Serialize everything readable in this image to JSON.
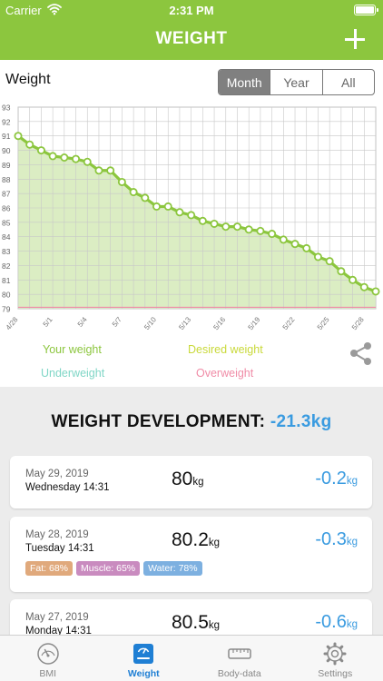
{
  "status_bar": {
    "carrier": "Carrier",
    "time": "2:31 PM"
  },
  "nav": {
    "title": "WEIGHT"
  },
  "chart_title": "Weight",
  "period_tabs": [
    "Month",
    "Year",
    "All"
  ],
  "active_period": "Month",
  "legend": {
    "your_weight": "Your weight",
    "desired_weight": "Desired weight",
    "underweight": "Underweight",
    "overweight": "Overweight"
  },
  "development": {
    "label": "WEIGHT DEVELOPMENT:",
    "value": "-21.3kg"
  },
  "entries": [
    {
      "date": "May 29, 2019",
      "day_time": "Wednesday 14:31",
      "weight": "80",
      "weight_unit": "kg",
      "change": "-0.2",
      "change_unit": "kg",
      "tags": []
    },
    {
      "date": "May 28, 2019",
      "day_time": "Tuesday 14:31",
      "weight": "80.2",
      "weight_unit": "kg",
      "change": "-0.3",
      "change_unit": "kg",
      "tags": [
        {
          "label": "Fat: 68%",
          "color": "#e0a97c"
        },
        {
          "label": "Muscle: 65%",
          "color": "#c98bbf"
        },
        {
          "label": "Water: 78%",
          "color": "#7db0e0"
        }
      ]
    },
    {
      "date": "May 27, 2019",
      "day_time": "Monday 14:31",
      "weight": "80.5",
      "weight_unit": "kg",
      "change": "-0.6",
      "change_unit": "kg",
      "tags": []
    }
  ],
  "tabs": [
    {
      "label": "BMI",
      "icon": "gauge-icon"
    },
    {
      "label": "Weight",
      "icon": "scale-icon"
    },
    {
      "label": "Body-data",
      "icon": "tape-measure-icon"
    },
    {
      "label": "Settings",
      "icon": "gear-icon"
    }
  ],
  "active_tab": "Weight",
  "colors": {
    "brand_green": "#8cc63e",
    "your_weight": "#8cc63e",
    "desired_weight": "#c9d93a",
    "underweight": "#7fd6c6",
    "overweight": "#f08ca7",
    "accent_blue": "#3a9be0"
  },
  "chart_data": {
    "type": "line",
    "title": "Weight",
    "xlabel": "",
    "ylabel": "",
    "ylim": [
      79,
      93
    ],
    "y_ticks": [
      79,
      80,
      81,
      82,
      83,
      84,
      85,
      86,
      87,
      88,
      89,
      90,
      91,
      92,
      93
    ],
    "x_tick_labels": [
      "4/28",
      "5/1",
      "5/4",
      "5/7",
      "5/10",
      "5/13",
      "5/16",
      "5/19",
      "5/22",
      "5/25",
      "5/28"
    ],
    "grid": true,
    "area_fill": true,
    "series": [
      {
        "name": "Your weight",
        "x": [
          "4/28",
          "4/29",
          "4/30",
          "5/1",
          "5/2",
          "5/3",
          "5/4",
          "5/5",
          "5/6",
          "5/7",
          "5/8",
          "5/9",
          "5/10",
          "5/11",
          "5/12",
          "5/13",
          "5/14",
          "5/15",
          "5/16",
          "5/17",
          "5/18",
          "5/19",
          "5/20",
          "5/21",
          "5/22",
          "5/23",
          "5/24",
          "5/25",
          "5/26",
          "5/27",
          "5/28",
          "5/29"
        ],
        "values": [
          91.0,
          90.4,
          90.0,
          89.6,
          89.5,
          89.4,
          89.2,
          88.6,
          88.6,
          87.8,
          87.1,
          86.7,
          86.1,
          86.1,
          85.7,
          85.5,
          85.1,
          84.9,
          84.7,
          84.7,
          84.5,
          84.4,
          84.2,
          83.8,
          83.5,
          83.2,
          82.6,
          82.3,
          81.6,
          81.0,
          80.5,
          80.2
        ]
      },
      {
        "name": "Overweight",
        "values": [
          79.1
        ]
      }
    ]
  }
}
